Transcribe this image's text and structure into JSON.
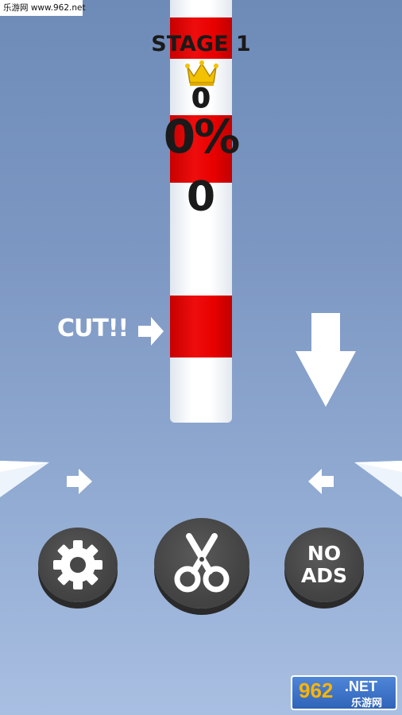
{
  "watermark": {
    "top_text": "乐游网 www.962.net",
    "bottom_num": "962",
    "bottom_net": ".NET",
    "bottom_cn": "乐游网"
  },
  "hud": {
    "stage_title": "STAGE 1",
    "best_score": "0",
    "progress": "0%",
    "score": "0",
    "crown_icon": "crown-icon"
  },
  "hint": {
    "cut_label": "CUT!!"
  },
  "buttons": {
    "settings_icon": "gear-icon",
    "cut_icon": "scissors-icon",
    "no_ads_line1": "NO",
    "no_ads_line2": "ADS"
  },
  "colors": {
    "pole_white": "#ffffff",
    "band_red": "#e80000",
    "button_gray": "#444444",
    "crown_gold": "#f2c200",
    "background_top": "#6e8bb8",
    "background_bottom": "#a9bfe2"
  }
}
